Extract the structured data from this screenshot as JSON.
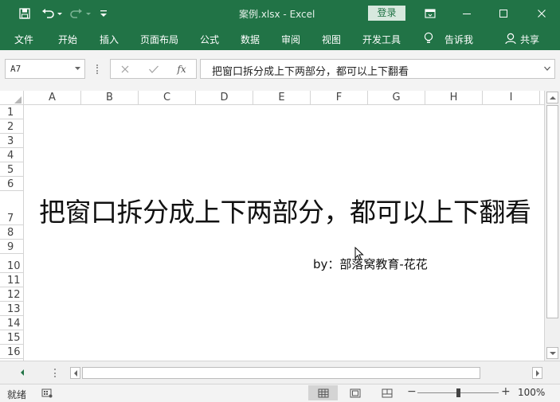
{
  "window": {
    "title": "案例.xlsx  -  Excel",
    "login_label": "登录"
  },
  "ribbon": {
    "tabs": [
      "文件",
      "开始",
      "插入",
      "页面布局",
      "公式",
      "数据",
      "审阅",
      "视图",
      "开发工具"
    ],
    "tell_me": "告诉我",
    "share": "共享"
  },
  "formula_bar": {
    "name_box": "A7",
    "fx_label": "fx",
    "content": "把窗口拆分成上下两部分，都可以上下翻看"
  },
  "columns": [
    "A",
    "B",
    "C",
    "D",
    "E",
    "F",
    "G",
    "H",
    "I"
  ],
  "rows": [
    "1",
    "2",
    "3",
    "4",
    "5",
    "6",
    "7",
    "8",
    "9",
    "10",
    "11",
    "12",
    "13",
    "14",
    "15",
    "16"
  ],
  "cells": {
    "a7": "把窗口拆分成上下两部分，都可以上下翻看",
    "byline": "by：部落窝教育-花花"
  },
  "status_bar": {
    "ready": "就绪",
    "zoom_minus": "−",
    "zoom_plus": "+",
    "zoom_level": "100%",
    "zoom_fraction": 0.5
  },
  "colors": {
    "accent": "#217346",
    "login_bg": "#d7e8de"
  }
}
